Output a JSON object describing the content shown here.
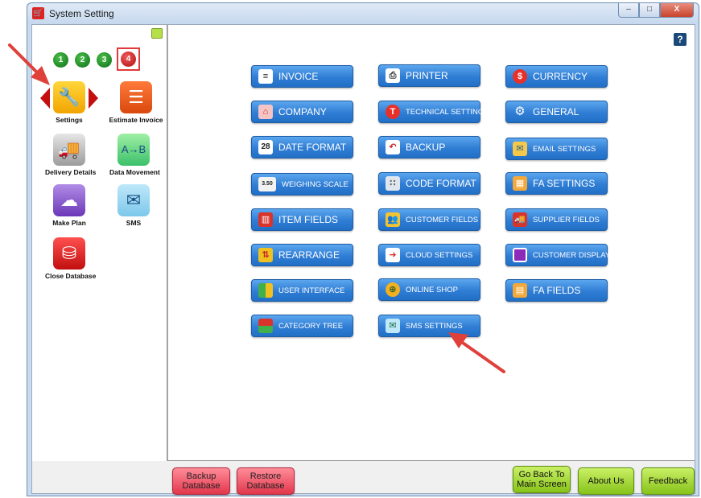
{
  "window": {
    "title": "System Setting"
  },
  "controls": {
    "minimize": "–",
    "maximize": "□",
    "close": "X"
  },
  "left": {
    "pages": [
      "1",
      "2",
      "3",
      "4"
    ],
    "active_page": "4",
    "tiles": [
      {
        "label": "Settings",
        "icon": "tools-icon"
      },
      {
        "label": "Estimate Invoice",
        "icon": "estimate-invoice-icon"
      },
      {
        "label": "Delivery Details",
        "icon": "truck-icon"
      },
      {
        "label": "Data Movement",
        "icon": "data-movement-icon"
      },
      {
        "label": "Make Plan",
        "icon": "cloud-icon"
      },
      {
        "label": "SMS",
        "icon": "sms-icon"
      },
      {
        "label": "Close Database",
        "icon": "database-icon"
      }
    ]
  },
  "main": {
    "help": "?",
    "buttons": [
      {
        "label": "INVOICE",
        "icon": "invoice-icon"
      },
      {
        "label": "PRINTER",
        "icon": "printer-icon"
      },
      {
        "label": "CURRENCY",
        "icon": "currency-icon"
      },
      {
        "label": "COMPANY",
        "icon": "company-icon"
      },
      {
        "label": "TECHNICAL SETTINGS",
        "icon": "technical-settings-icon"
      },
      {
        "label": "GENERAL",
        "icon": "gear-icon"
      },
      {
        "label": "DATE FORMAT",
        "icon": "calendar-icon"
      },
      {
        "label": "BACKUP",
        "icon": "backup-icon"
      },
      {
        "label": "EMAIL SETTINGS",
        "icon": "email-icon"
      },
      {
        "label": "WEIGHING SCALE",
        "icon": "weighing-scale-icon"
      },
      {
        "label": "CODE FORMAT",
        "icon": "code-format-icon"
      },
      {
        "label": "FA SETTINGS",
        "icon": "fa-settings-icon"
      },
      {
        "label": "ITEM FIELDS",
        "icon": "item-fields-icon"
      },
      {
        "label": "CUSTOMER FIELDS",
        "icon": "customer-fields-icon"
      },
      {
        "label": "SUPPLIER FIELDS",
        "icon": "supplier-fields-icon"
      },
      {
        "label": "REARRANGE",
        "icon": "rearrange-icon"
      },
      {
        "label": "CLOUD SETTINGS",
        "icon": "cloud-settings-icon"
      },
      {
        "label": "CUSTOMER DISPLAY",
        "icon": "customer-display-icon"
      },
      {
        "label": "USER INTERFACE",
        "icon": "user-interface-icon"
      },
      {
        "label": "ONLINE SHOP",
        "icon": "globe-icon"
      },
      {
        "label": "FA FIELDS",
        "icon": "fa-fields-icon"
      },
      {
        "label": "CATEGORY TREE",
        "icon": "category-tree-icon"
      },
      {
        "label": "SMS SETTINGS",
        "icon": "sms-settings-icon"
      }
    ]
  },
  "bottom": {
    "backup": "Backup Database",
    "restore": "Restore Database",
    "go_back": "Go Back To Main Screen",
    "about": "About Us",
    "feedback": "Feedback"
  },
  "colors": {
    "accent_blue": "#2f7dd4",
    "alert_red": "#e03a3a",
    "ok_green": "#87c21a"
  }
}
